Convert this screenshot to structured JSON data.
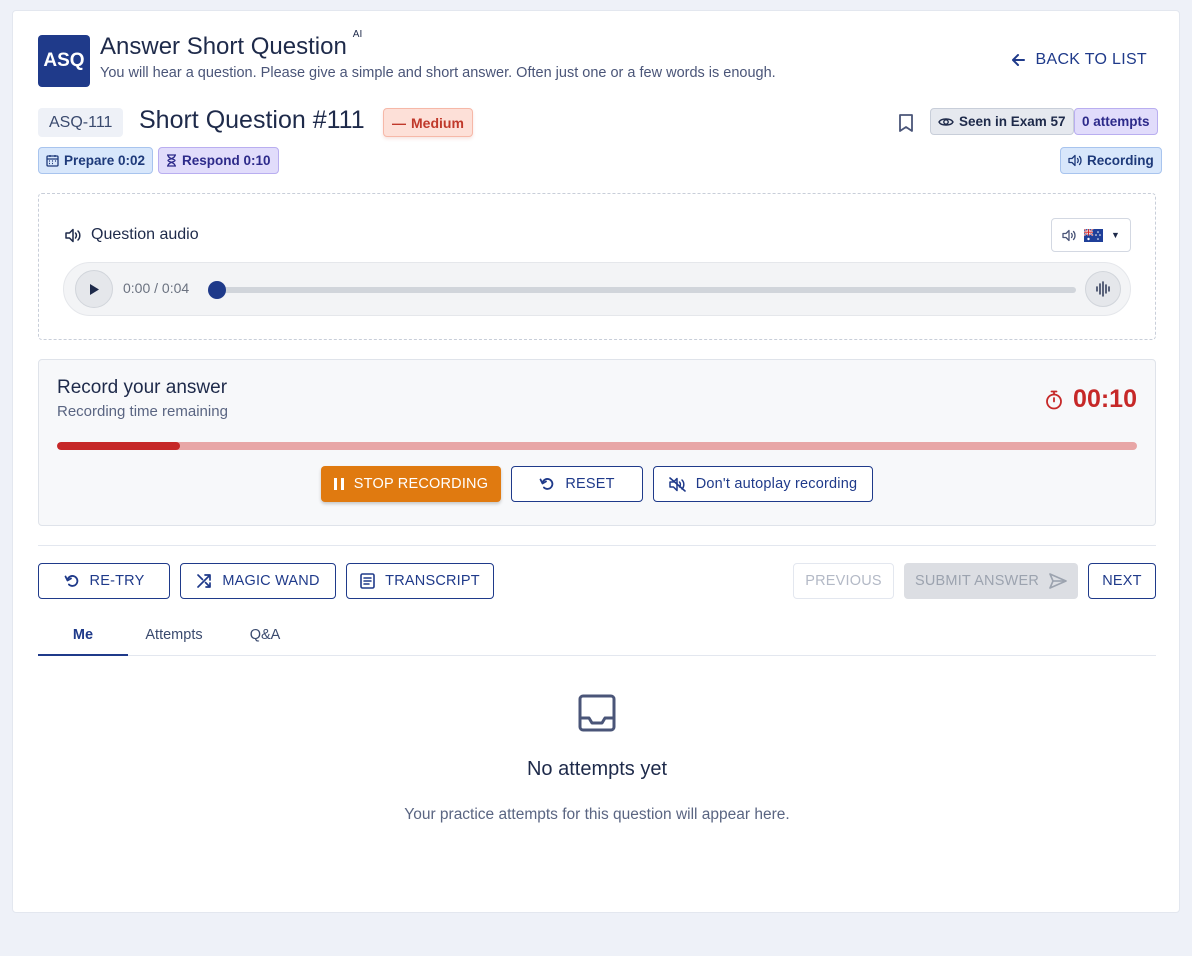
{
  "header": {
    "logo_text": "ASQ",
    "title": "Answer Short Question",
    "ai_tag": "AI",
    "subtitle": "You will hear a question. Please give a simple and short answer. Often just one or a few words is enough.",
    "back_label": "BACK TO LIST"
  },
  "question": {
    "id": "ASQ-111",
    "title": "Short Question #111",
    "difficulty": "Medium",
    "seen_label": "Seen in Exam 57",
    "attempts_label": "0 attempts",
    "prepare_label": "Prepare 0:02",
    "respond_label": "Respond 0:10",
    "mode_label": "Recording"
  },
  "audio": {
    "label": "Question audio",
    "time": "0:00 / 0:04",
    "progress": 0
  },
  "record": {
    "title": "Record your answer",
    "subtitle": "Recording time remaining",
    "timer": "00:10",
    "progress": 0.114,
    "stop_label": "STOP RECORDING",
    "reset_label": "RESET",
    "autoplay_label": "Don't autoplay recording"
  },
  "actions": {
    "retry": "RE-TRY",
    "magic": "MAGIC WAND",
    "transcript": "TRANSCRIPT",
    "previous": "PREVIOUS",
    "submit": "SUBMIT ANSWER",
    "next": "NEXT"
  },
  "tabs": [
    "Me",
    "Attempts",
    "Q&A"
  ],
  "empty": {
    "title": "No attempts yet",
    "text": "Your practice attempts for this question will appear here."
  },
  "colors": {
    "primary": "#1f3a8a",
    "record_red": "#c62828",
    "stop_orange": "#e07a10"
  }
}
